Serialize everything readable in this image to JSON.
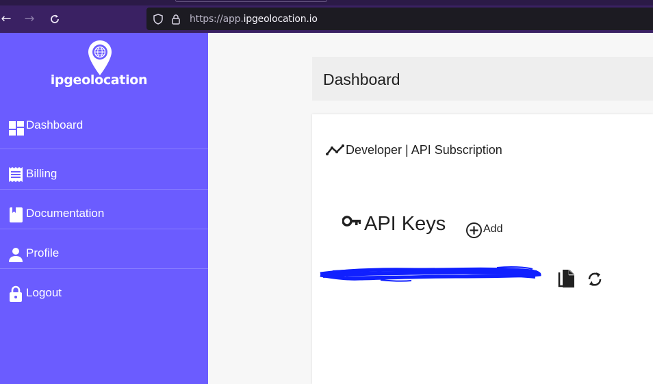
{
  "browser": {
    "url_prefix": "https://app.",
    "url_host": "ipgeolocation.io"
  },
  "sidebar": {
    "logo_text": "ipgeolocation",
    "items": [
      {
        "label": "Dashboard",
        "icon": "dashboard-icon"
      },
      {
        "label": "Billing",
        "icon": "receipt-icon"
      },
      {
        "label": "Documentation",
        "icon": "book-icon"
      },
      {
        "label": "Profile",
        "icon": "person-icon"
      },
      {
        "label": "Logout",
        "icon": "lock-icon"
      }
    ]
  },
  "main": {
    "page_title": "Dashboard",
    "subscription_label": "Developer | API Subscription",
    "api_keys_title": "API Keys",
    "add_label": "Add"
  },
  "colors": {
    "sidebar": "#6b5cff",
    "browser_toolbar": "#3a2163",
    "redaction": "#1020ff"
  }
}
